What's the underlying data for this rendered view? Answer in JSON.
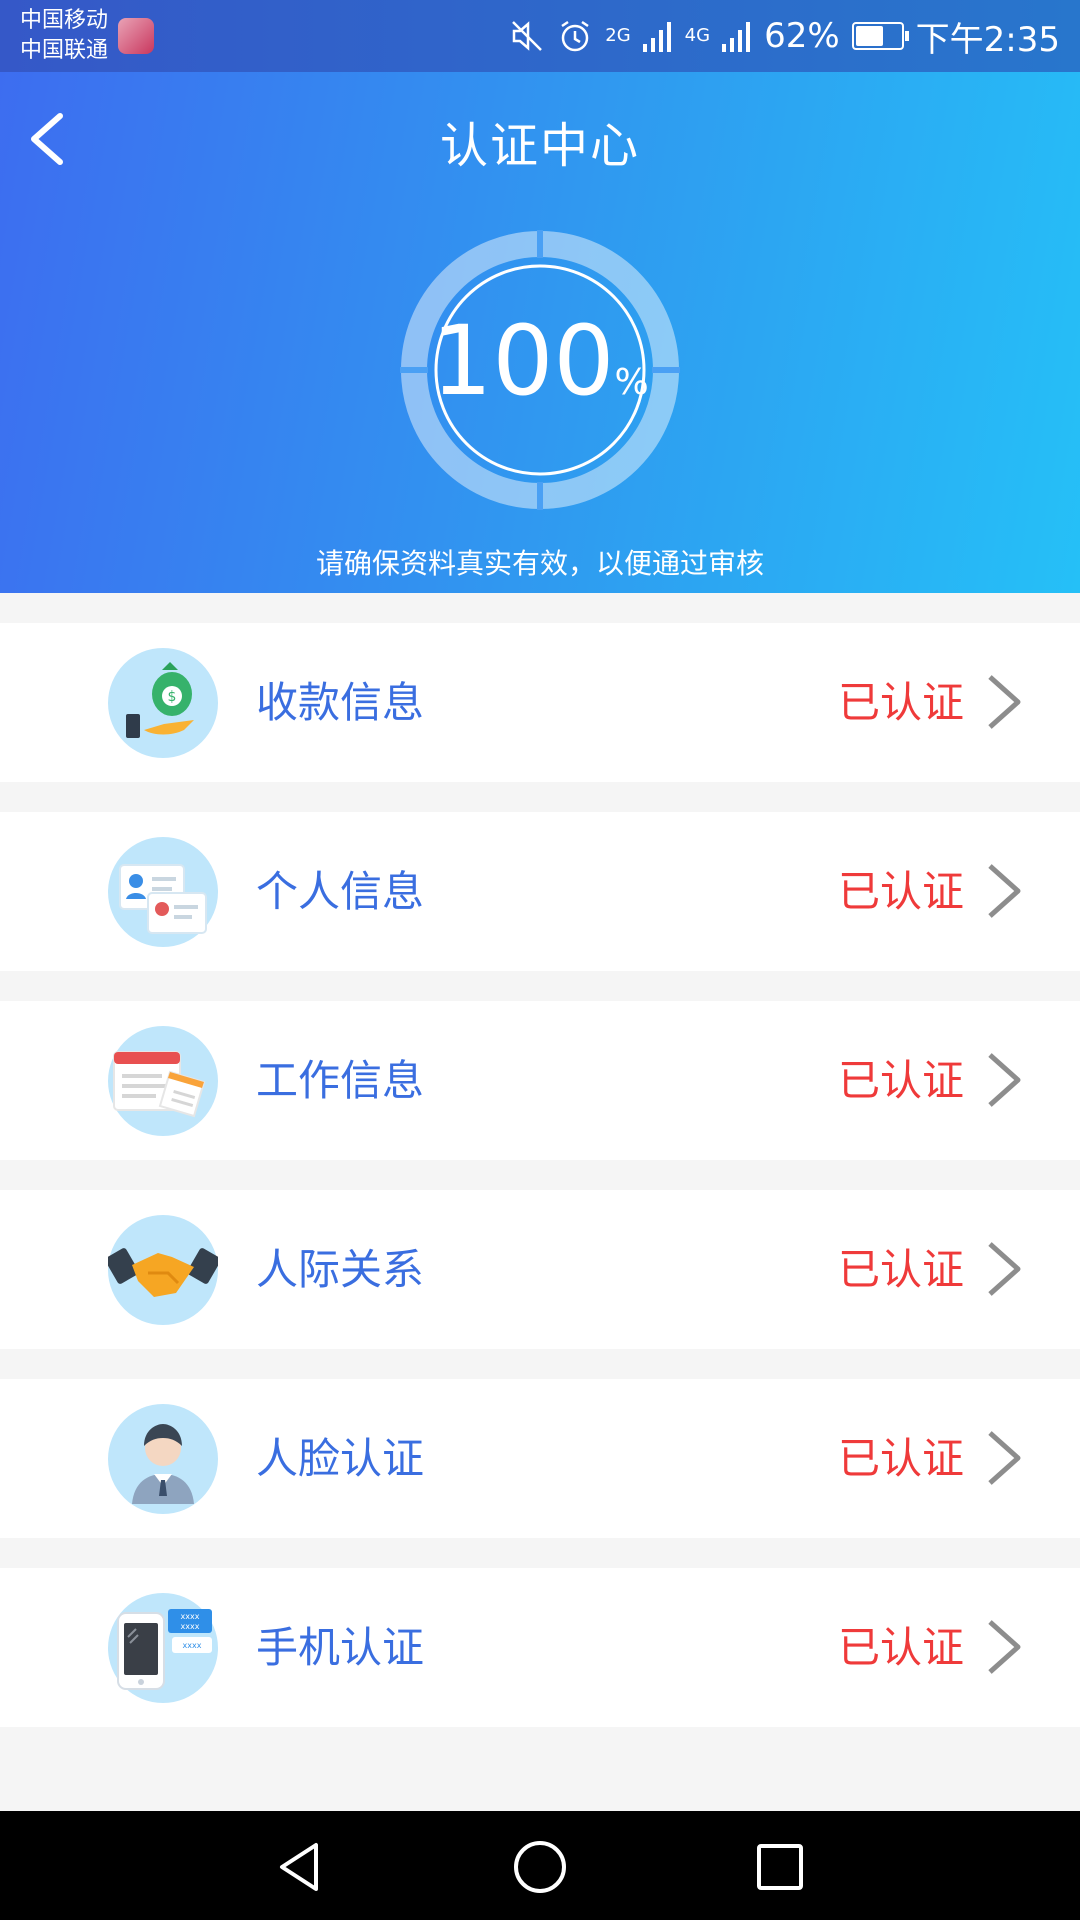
{
  "status_bar": {
    "carrier_1": "中国移动",
    "carrier_2": "中国联通",
    "network_1": "2G",
    "network_2": "4G",
    "battery": "62%",
    "battery_level": 0.62,
    "time": "下午2:35"
  },
  "header": {
    "title": "认证中心",
    "progress_value": "100",
    "progress_unit": "%",
    "progress_fraction": 1.0,
    "subtitle": "请确保资料真实有效，以便通过审核"
  },
  "items": [
    {
      "label": "收款信息",
      "status": "已认证",
      "icon": "money-bag-icon"
    },
    {
      "label": "个人信息",
      "status": "已认证",
      "icon": "id-card-icon"
    },
    {
      "label": "工作信息",
      "status": "已认证",
      "icon": "document-icon"
    },
    {
      "label": "人际关系",
      "status": "已认证",
      "icon": "handshake-icon"
    },
    {
      "label": "人脸认证",
      "status": "已认证",
      "icon": "person-avatar-icon"
    },
    {
      "label": "手机认证",
      "status": "已认证",
      "icon": "phone-sms-icon"
    }
  ],
  "colors": {
    "header_start": "#3d6df0",
    "header_end": "#25c0f7",
    "label": "#3a6ee0",
    "status": "#ef3a3a",
    "icon_bg": "#bfe6fb"
  }
}
